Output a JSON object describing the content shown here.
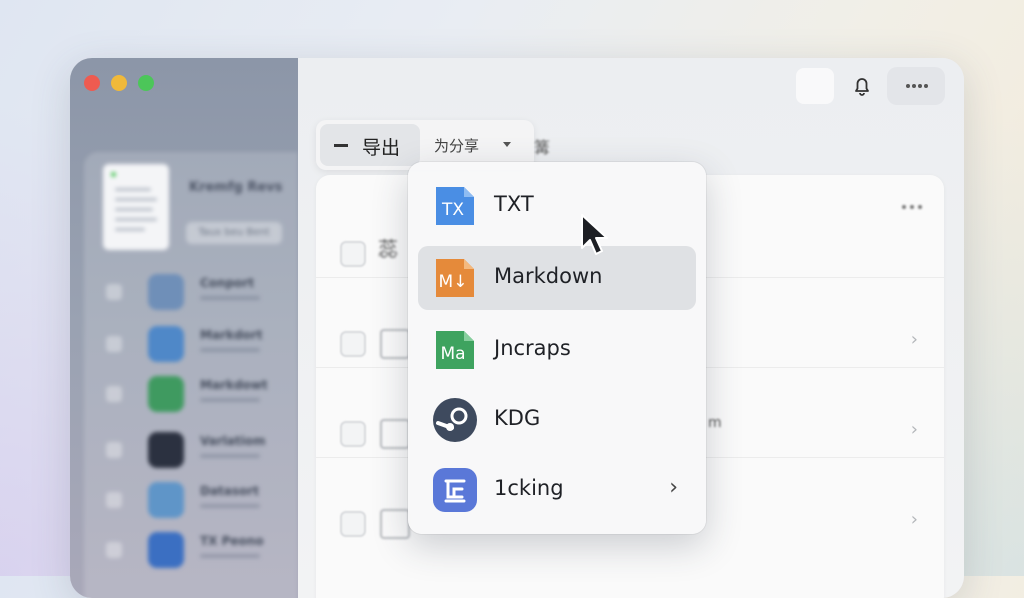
{
  "sidebar": {
    "doc_title": "Kremfg  Revs",
    "doc_chip": "Taux beu Bent",
    "items": [
      {
        "label": "Conport",
        "color": "#6f8fb8"
      },
      {
        "label": "Markdort",
        "color": "#4f88c8"
      },
      {
        "label": "Markdowt",
        "color": "#3f9a60"
      },
      {
        "label": "Varlatiom",
        "color": "#2b3140"
      },
      {
        "label": "Datasort",
        "color": "#5f95c8"
      },
      {
        "label": "TX Peono",
        "color": "#3b6fc2"
      }
    ]
  },
  "toolbar": {
    "export_label": "导出",
    "share_label": "为分享",
    "after_label": "篝"
  },
  "list": {
    "rows": [
      {
        "text": "蕊"
      },
      {
        "text": ""
      },
      {
        "text": "",
        "right_text": "m"
      },
      {
        "text": ""
      }
    ]
  },
  "menu": {
    "items": [
      {
        "label": "TXT",
        "icon_text": "TX",
        "icon_color": "#4a8ee4",
        "icon": "txt-file-icon"
      },
      {
        "label": "Markdown",
        "icon_text": "M↓",
        "icon_color": "#e58a3a",
        "icon": "markdown-file-icon"
      },
      {
        "label": "Jncraps",
        "icon_text": "Ma",
        "icon_color": "#3ea35f",
        "icon": "spreadsheet-file-icon"
      },
      {
        "label": "KDG",
        "icon_text": "",
        "icon_color": "#3e4a5e",
        "icon": "steam-icon"
      },
      {
        "label": "1cking",
        "icon_text": "",
        "icon_color": "#5a78d8",
        "icon": "linking-icon"
      }
    ]
  }
}
